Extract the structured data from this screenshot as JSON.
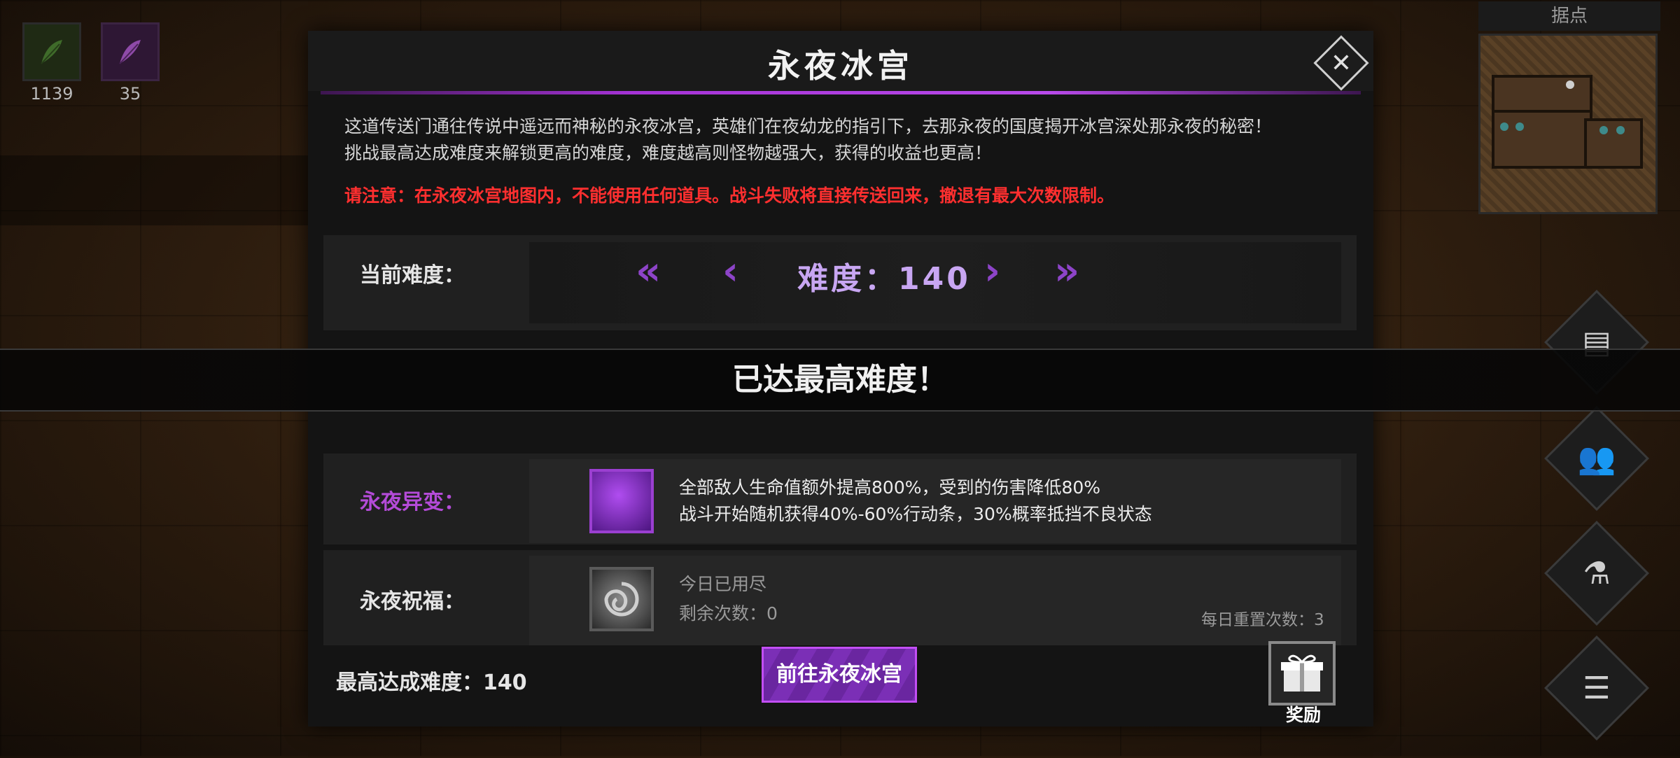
{
  "resources": [
    {
      "icon": "green-feather-icon",
      "count": "1139"
    },
    {
      "icon": "purple-feather-icon",
      "count": "35"
    }
  ],
  "minimap": {
    "label": "据点"
  },
  "dialog": {
    "title": "永夜冰宫",
    "close_icon": "close-icon",
    "description_line1": "这道传送门通往传说中遥远而神秘的永夜冰宫，英雄们在夜幼龙的指引下，去那永夜的国度揭开冰宫深处那永夜的秘密！",
    "description_line2": "挑战最高达成难度来解锁更高的难度，难度越高则怪物越强大，获得的收益也更高！",
    "warning": "请注意：在永夜冰宫地图内，不能使用任何道具。战斗失败将直接传送回来，撤退有最大次数限制。",
    "difficulty": {
      "label": "当前难度：",
      "value": "难度：140"
    },
    "banner": "已达最高难度！",
    "mutation": {
      "label": "永夜异变：",
      "line1": "全部敌人生命值额外提高800%，受到的伤害降低80%",
      "line2": "战斗开始随机获得40%-60%行动条，30%概率抵挡不良状态"
    },
    "blessing": {
      "label": "永夜祝福：",
      "status": "今日已用尽",
      "remaining": "剩余次数：0",
      "daily_reset": "每日重置次数：3"
    },
    "footer": {
      "max_reached": "最高达成难度：140",
      "go_button": "前往永夜冰宫",
      "reward_label": "奖励"
    }
  },
  "colors": {
    "accent_purple": "#a533d6",
    "warning_red": "#ff2f2f"
  }
}
